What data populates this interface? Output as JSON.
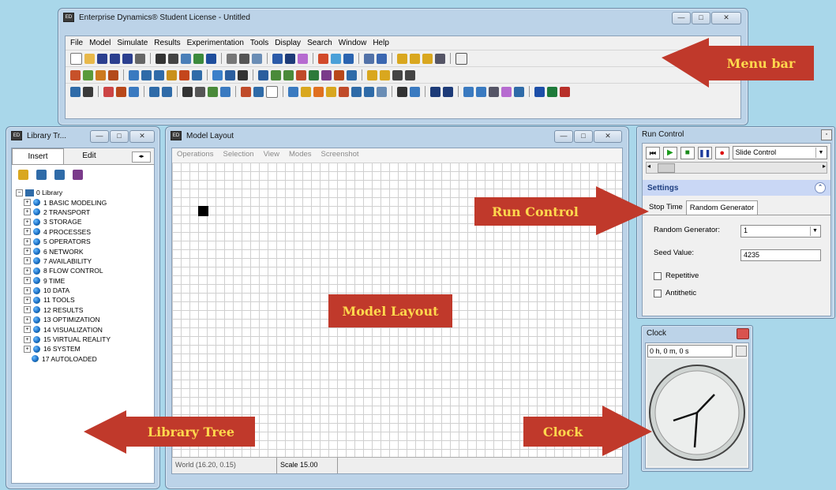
{
  "main_window": {
    "title": "Enterprise Dynamics® Student License - Untitled",
    "menu": [
      "File",
      "Model",
      "Simulate",
      "Results",
      "Experimentation",
      "Tools",
      "Display",
      "Search",
      "Window",
      "Help"
    ]
  },
  "library_window": {
    "title": "Library Tr...",
    "tabs": [
      "Insert",
      "Edit"
    ],
    "root": "0 Library",
    "items": [
      "1 BASIC MODELING",
      "2 TRANSPORT",
      "3 STORAGE",
      "4 PROCESSES",
      "5 OPERATORS",
      "6 NETWORK",
      "7 AVAILABILITY",
      "8 FLOW CONTROL",
      "9 TIME",
      "10 DATA",
      "11 TOOLS",
      "12 RESULTS",
      "13 OPTIMIZATION",
      "14 VISUALIZATION",
      "15 VIRTUAL REALITY",
      "16 SYSTEM",
      "17 AUTOLOADED"
    ]
  },
  "model_window": {
    "title": "Model Layout",
    "menu": [
      "Operations",
      "Selection",
      "View",
      "Modes",
      "Screenshot"
    ],
    "status_world": "World (16.20, 0.15)",
    "status_scale": "Scale 15.00"
  },
  "run_control": {
    "title": "Run Control",
    "speed_option": "Slide Control",
    "settings_header": "Settings",
    "tabs": [
      "Stop Time",
      "Random Generator"
    ],
    "random_generator_label": "Random Generator:",
    "random_generator_value": "1",
    "seed_label": "Seed Value:",
    "seed_value": "4235",
    "repetitive_label": "Repetitive",
    "antithetic_label": "Antithetic"
  },
  "clock": {
    "title": "Clock",
    "time": "0 h, 0 m, 0 s"
  },
  "callouts": {
    "menu_bar": "Menu bar",
    "run_control": "Run Control",
    "model_layout": "Model Layout",
    "library_tree": "Library Tree",
    "clock": "Clock"
  },
  "colors": {
    "background": "#a9d7ea",
    "callout_fill": "#c0392b",
    "callout_text": "#ffd84d",
    "settings_header": "#c9d7f5"
  }
}
